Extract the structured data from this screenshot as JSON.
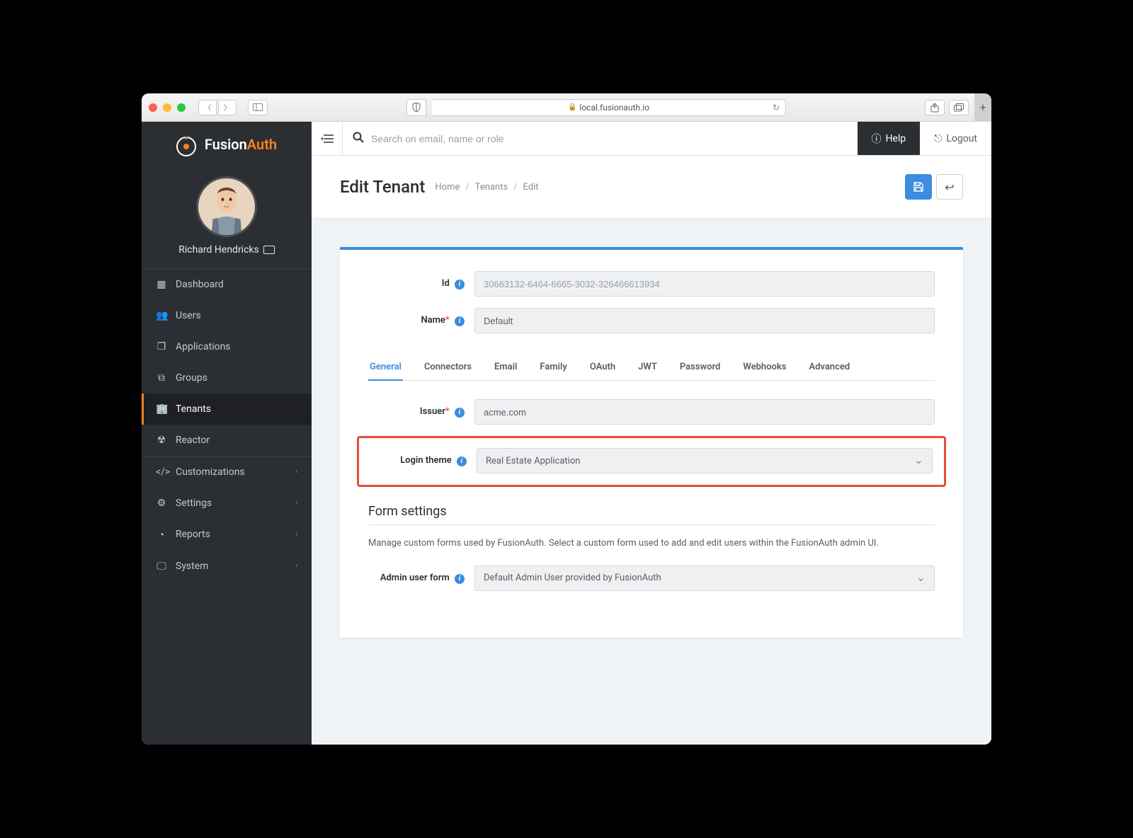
{
  "browser": {
    "url": "local.fusionauth.io"
  },
  "brand": {
    "name1": "Fusion",
    "name2": "Auth"
  },
  "user": {
    "name": "Richard Hendricks"
  },
  "sidebar": {
    "items": [
      {
        "label": "Dashboard"
      },
      {
        "label": "Users"
      },
      {
        "label": "Applications"
      },
      {
        "label": "Groups"
      },
      {
        "label": "Tenants"
      },
      {
        "label": "Reactor"
      }
    ],
    "groups": [
      {
        "label": "Customizations"
      },
      {
        "label": "Settings"
      },
      {
        "label": "Reports"
      },
      {
        "label": "System"
      }
    ]
  },
  "topbar": {
    "search_placeholder": "Search on email, name or role",
    "help": "Help",
    "logout": "Logout"
  },
  "page": {
    "title": "Edit Tenant",
    "breadcrumb": [
      "Home",
      "Tenants",
      "Edit"
    ]
  },
  "form": {
    "id_label": "Id",
    "id_value": "30663132-6464-6665-3032-326466613934",
    "name_label": "Name",
    "name_value": "Default",
    "tabs": [
      "General",
      "Connectors",
      "Email",
      "Family",
      "OAuth",
      "JWT",
      "Password",
      "Webhooks",
      "Advanced"
    ],
    "issuer_label": "Issuer",
    "issuer_value": "acme.com",
    "login_theme_label": "Login theme",
    "login_theme_value": "Real Estate Application",
    "section_title": "Form settings",
    "section_desc": "Manage custom forms used by FusionAuth. Select a custom form used to add and edit users within the FusionAuth admin UI.",
    "admin_form_label": "Admin user form",
    "admin_form_value": "Default Admin User provided by FusionAuth"
  }
}
